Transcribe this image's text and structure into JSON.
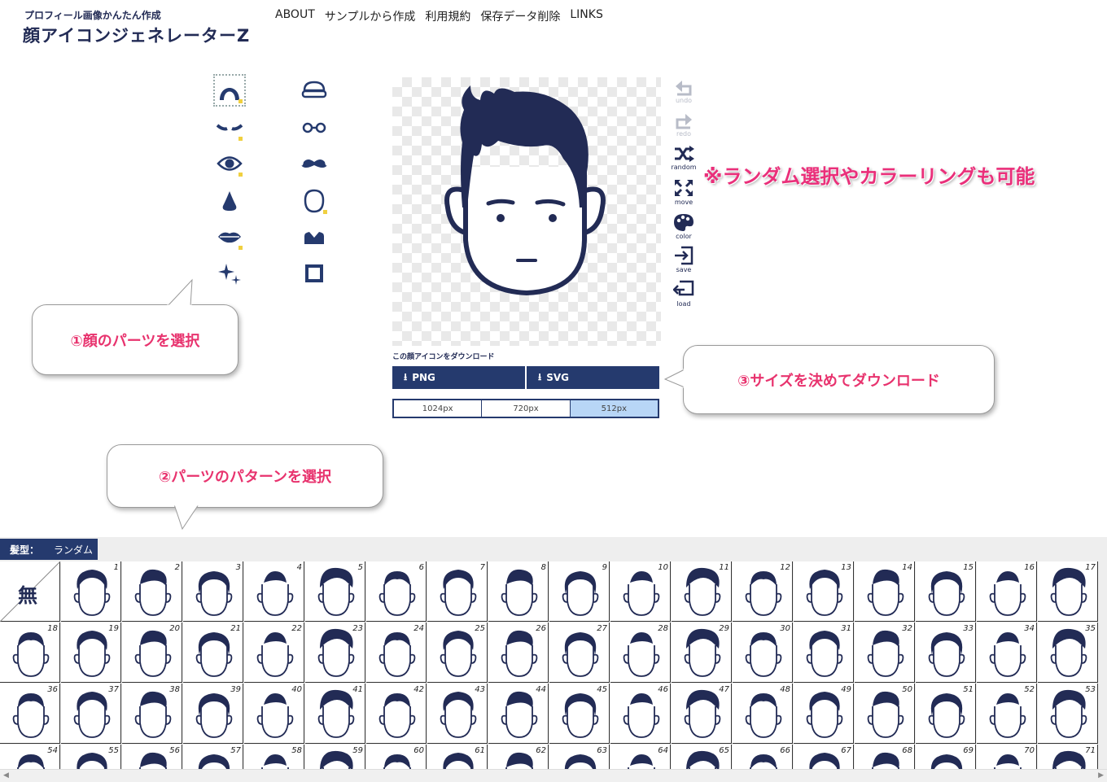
{
  "header": {
    "subtitle": "プロフィール画像かんたん作成",
    "title": "顔アイコンジェネレーターZ",
    "nav": [
      "ABOUT",
      "サンプルから作成",
      "利用規約",
      "保存データ削除",
      "LINKS"
    ]
  },
  "parts_left": [
    "hair-icon",
    "eyebrows-icon",
    "eye-icon",
    "nose-icon",
    "mouth-icon",
    "sparkle-icon"
  ],
  "parts_right": [
    "hat-icon",
    "glasses-icon",
    "mustache-icon",
    "face-outline-icon",
    "clothes-icon",
    "frame-icon"
  ],
  "tools": [
    {
      "label": "undo",
      "icon": "undo-icon"
    },
    {
      "label": "redo",
      "icon": "redo-icon"
    },
    {
      "label": "random",
      "icon": "shuffle-icon"
    },
    {
      "label": "move",
      "icon": "move-icon"
    },
    {
      "label": "color",
      "icon": "palette-icon"
    },
    {
      "label": "save",
      "icon": "save-icon"
    },
    {
      "label": "load",
      "icon": "load-icon"
    }
  ],
  "download": {
    "label": "この顔アイコンをダウンロード",
    "png": "PNG",
    "svg": "SVG",
    "sizes": [
      "1024px",
      "720px",
      "512px"
    ],
    "selected_size": "512px"
  },
  "callouts": {
    "select_parts": "①顔のパーツを選択",
    "select_pattern": "②パーツのパターンを選択",
    "download": "③サイズを決めてダウンロード",
    "random_color": "※ランダム選択やカラーリングも可能"
  },
  "panel": {
    "category": "髪型：",
    "random": "ランダム",
    "none_label": "無",
    "numbers": [
      1,
      2,
      3,
      4,
      5,
      6,
      7,
      8,
      9,
      10,
      11,
      12,
      13,
      14,
      15,
      16,
      17,
      18,
      19,
      20,
      21,
      22,
      23,
      24,
      25,
      26,
      27,
      28,
      29,
      30,
      31,
      32,
      33,
      34,
      35,
      36,
      37,
      38,
      39,
      40,
      41,
      42,
      43,
      44,
      45,
      46,
      47,
      48,
      49,
      50,
      51,
      52,
      53,
      54,
      55,
      56,
      57,
      58,
      59,
      60,
      61,
      62,
      63,
      64,
      65,
      66,
      67,
      68,
      69,
      70,
      71
    ]
  },
  "colors": {
    "navy": "#222b55",
    "accent": "#e8336e",
    "selected_size": "#b8d6f6"
  }
}
